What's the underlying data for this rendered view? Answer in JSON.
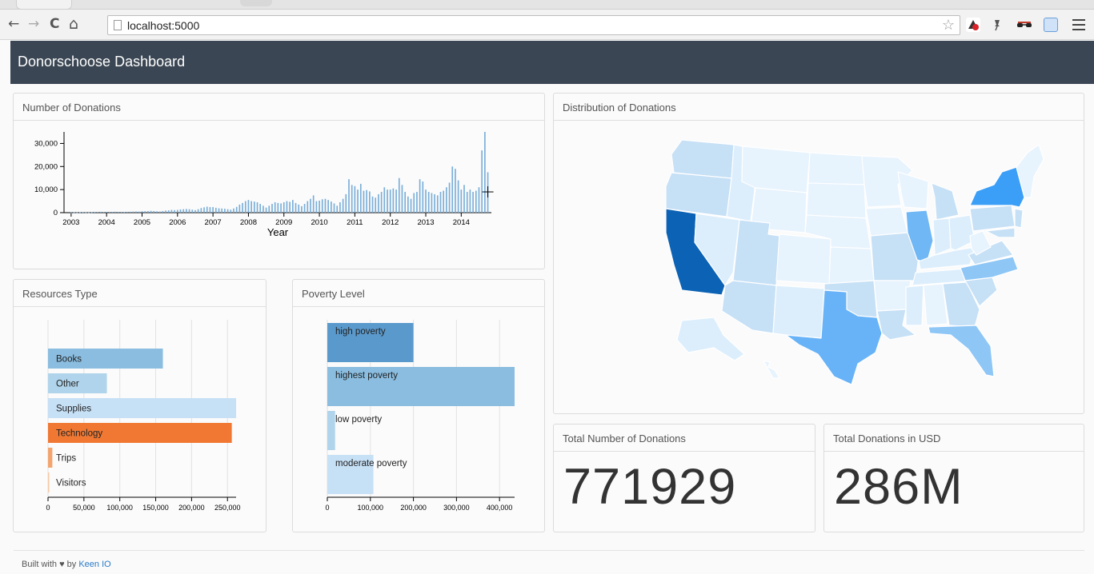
{
  "browser": {
    "url": "localhost:5000",
    "nav": {
      "back": "←",
      "forward": "→",
      "reload": "C",
      "home": "⌂"
    },
    "icons": [
      "star-icon",
      "acrobat-icon",
      "pin-icon",
      "glasses-icon",
      "screenshot-icon",
      "menu-icon"
    ]
  },
  "app": {
    "title": "Donorschoose Dashboard"
  },
  "panels": {
    "donations_over_time": "Number of Donations",
    "distribution": "Distribution of Donations",
    "resources": "Resources Type",
    "poverty": "Poverty Level",
    "total_count": "Total Number of Donations",
    "total_usd": "Total Donations in USD"
  },
  "stats": {
    "total_count": "771929",
    "total_usd": "286M"
  },
  "footer": {
    "prefix": "Built with ♥ by",
    "link": "Keen IO"
  },
  "colors": {
    "appbar": "#3a4653",
    "orange": "#f07833",
    "blue_dark": "#5a99cc",
    "blue_mid": "#8abde0",
    "blue_light": "#b0d4eb",
    "blue_pale": "#c6e0f6"
  },
  "chart_data": [
    {
      "type": "bar",
      "title": "Number of Donations",
      "xlabel": "Year",
      "ylabel": "",
      "x_ticks": [
        "2003",
        "2004",
        "2005",
        "2006",
        "2007",
        "2008",
        "2009",
        "2010",
        "2011",
        "2012",
        "2013",
        "2014"
      ],
      "y_ticks": [
        "0",
        "10,000",
        "20,000",
        "30,000"
      ],
      "ylim": [
        0,
        35000
      ],
      "xlim": [
        2002.8,
        2014.85
      ],
      "x": [
        2003.0,
        2003.083,
        2003.167,
        2003.25,
        2003.333,
        2003.417,
        2003.5,
        2003.583,
        2003.667,
        2003.75,
        2003.833,
        2003.917,
        2004.0,
        2004.083,
        2004.167,
        2004.25,
        2004.333,
        2004.417,
        2004.5,
        2004.583,
        2004.667,
        2004.75,
        2004.833,
        2004.917,
        2005.0,
        2005.083,
        2005.167,
        2005.25,
        2005.333,
        2005.417,
        2005.5,
        2005.583,
        2005.667,
        2005.75,
        2005.833,
        2005.917,
        2006.0,
        2006.083,
        2006.167,
        2006.25,
        2006.333,
        2006.417,
        2006.5,
        2006.583,
        2006.667,
        2006.75,
        2006.833,
        2006.917,
        2007.0,
        2007.083,
        2007.167,
        2007.25,
        2007.333,
        2007.417,
        2007.5,
        2007.583,
        2007.667,
        2007.75,
        2007.833,
        2007.917,
        2008.0,
        2008.083,
        2008.167,
        2008.25,
        2008.333,
        2008.417,
        2008.5,
        2008.583,
        2008.667,
        2008.75,
        2008.833,
        2008.917,
        2009.0,
        2009.083,
        2009.167,
        2009.25,
        2009.333,
        2009.417,
        2009.5,
        2009.583,
        2009.667,
        2009.75,
        2009.833,
        2009.917,
        2010.0,
        2010.083,
        2010.167,
        2010.25,
        2010.333,
        2010.417,
        2010.5,
        2010.583,
        2010.667,
        2010.75,
        2010.833,
        2010.917,
        2011.0,
        2011.083,
        2011.167,
        2011.25,
        2011.333,
        2011.417,
        2011.5,
        2011.583,
        2011.667,
        2011.75,
        2011.833,
        2011.917,
        2012.0,
        2012.083,
        2012.167,
        2012.25,
        2012.333,
        2012.417,
        2012.5,
        2012.583,
        2012.667,
        2012.75,
        2012.833,
        2012.917,
        2013.0,
        2013.083,
        2013.167,
        2013.25,
        2013.333,
        2013.417,
        2013.5,
        2013.583,
        2013.667,
        2013.75,
        2013.833,
        2013.917,
        2014.0,
        2014.083,
        2014.167,
        2014.25,
        2014.333,
        2014.417,
        2014.5,
        2014.583,
        2014.667,
        2014.75
      ],
      "values": [
        100,
        150,
        120,
        180,
        200,
        150,
        100,
        200,
        250,
        300,
        350,
        300,
        300,
        350,
        300,
        400,
        350,
        300,
        250,
        350,
        400,
        450,
        500,
        450,
        600,
        650,
        700,
        800,
        700,
        600,
        500,
        700,
        900,
        1000,
        1200,
        1100,
        1200,
        1400,
        1500,
        1600,
        1500,
        1300,
        1100,
        1500,
        2000,
        2300,
        2600,
        2400,
        2400,
        2100,
        1900,
        1800,
        1700,
        1500,
        1300,
        1800,
        2500,
        3500,
        4200,
        5000,
        5500,
        5000,
        4800,
        4500,
        3800,
        3000,
        2200,
        3000,
        3800,
        4500,
        4200,
        4000,
        4500,
        5000,
        4700,
        5500,
        4200,
        3500,
        2800,
        3800,
        5000,
        6000,
        7500,
        5000,
        5200,
        5800,
        6000,
        5500,
        4800,
        4000,
        3000,
        4500,
        6000,
        8000,
        14500,
        12000,
        11500,
        10000,
        12500,
        9500,
        9800,
        9200,
        7000,
        6500,
        8000,
        9000,
        11000,
        10000,
        10000,
        10500,
        10000,
        15000,
        12000,
        9000,
        7000,
        6000,
        8500,
        9000,
        14500,
        13500,
        10000,
        9000,
        8500,
        8000,
        7500,
        9000,
        9500,
        11000,
        13000,
        20000,
        19000,
        14000,
        10000,
        12000,
        9000,
        10000,
        9000,
        9500,
        11000,
        27000,
        35000,
        17500
      ]
    },
    {
      "type": "bar",
      "orientation": "horizontal",
      "title": "Resources Type",
      "categories": [
        "Books",
        "Other",
        "Supplies",
        "Technology",
        "Trips",
        "Visitors"
      ],
      "values": [
        160000,
        82000,
        262000,
        256000,
        6000,
        1500
      ],
      "colors": [
        "#8abde0",
        "#b0d4eb",
        "#c6e0f6",
        "#f07833",
        "#f4a46e",
        "#f7c8a4"
      ],
      "x_ticks": [
        "0",
        "50,000",
        "100,000",
        "150,000",
        "200,000",
        "250,000"
      ],
      "xlim": [
        0,
        262000
      ]
    },
    {
      "type": "bar",
      "orientation": "horizontal",
      "title": "Poverty Level",
      "categories": [
        "high poverty",
        "highest poverty",
        "low poverty",
        "moderate poverty"
      ],
      "values": [
        200000,
        435000,
        18000,
        107000
      ],
      "colors": [
        "#5a99cc",
        "#8abde0",
        "#b0d4eb",
        "#c6e0f6"
      ],
      "x_ticks": [
        "0",
        "100,000",
        "200,000",
        "300,000",
        "400,000"
      ],
      "xlim": [
        0,
        435000
      ]
    }
  ]
}
